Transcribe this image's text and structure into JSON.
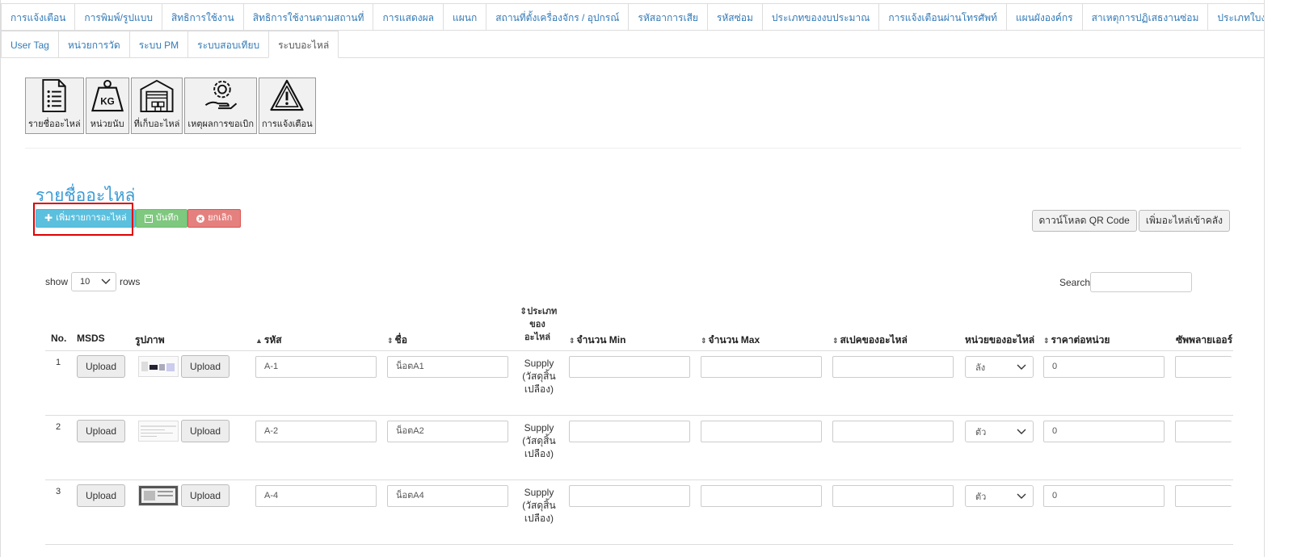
{
  "tabs_row1": [
    "การแจ้งเตือน",
    "การพิมพ์/รูปแบบ",
    "สิทธิการใช้งาน",
    "สิทธิการใช้งานตามสถานที่",
    "การแสดงผล",
    "แผนก",
    "สถานที่ตั้งเครื่องจักร / อุปกรณ์",
    "รหัสอาการเสีย",
    "รหัสซ่อม",
    "ประเภทของงบประมาณ",
    "การแจ้งเตือนผ่านโทรศัพท์",
    "แผนผังองค์กร",
    "สาเหตุการปฏิเสธงานซ่อม",
    "ประเภทใบงานซ่อม"
  ],
  "tabs_row2": [
    "User Tag",
    "หน่วยการวัด",
    "ระบบ PM",
    "ระบบสอบเทียบ",
    "ระบบอะไหล่"
  ],
  "active_tab": "ระบบอะไหล่",
  "icon_buttons": [
    {
      "label": "รายชื่ออะไหล่",
      "icon": "list-document-icon"
    },
    {
      "label": "หน่วยนับ",
      "icon": "weight-kg-icon"
    },
    {
      "label": "ที่เก็บอะไหล่",
      "icon": "warehouse-icon"
    },
    {
      "label": "เหตุผลการขอเบิก",
      "icon": "hand-gear-icon"
    },
    {
      "label": "การแจ้งเตือน",
      "icon": "warning-triangle-icon"
    }
  ],
  "page_title": "รายชื่ออะไหล่",
  "actions": {
    "add": "เพิ่มรายการอะไหล่",
    "save": "บันทึก",
    "cancel": "ยกเลิก"
  },
  "right_actions": {
    "qr": "ดาวน์โหลด QR Code",
    "stock": "เพิ่มอะไหล่เข้าคลัง"
  },
  "table_controls": {
    "show": "show",
    "rows_value": "10",
    "rows": "rows",
    "search": "Search"
  },
  "columns": {
    "no": "No.",
    "msds": "MSDS",
    "image": "รูปภาพ",
    "code": "รหัส",
    "name": "ชื่อ",
    "type_lines": [
      "ประเภท",
      "ของ",
      "อะไหล่"
    ],
    "min": "จำนวน Min",
    "max": "จำนวน Max",
    "spec": "สเปคของอะไหล่",
    "unit": "หน่วยของอะไหล่",
    "price": "ราคาต่อหน่วย",
    "supplier": "ซัพพลายเออร์"
  },
  "upload_label": "Upload",
  "rows": [
    {
      "no": "1",
      "code": "A-1",
      "name": "น็อตA1",
      "type_lines": [
        "Supply",
        "(วัสดุสิ้น",
        "เปลือง)"
      ],
      "unit": "ลัง",
      "price": "0"
    },
    {
      "no": "2",
      "code": "A-2",
      "name": "น็อตA2",
      "type_lines": [
        "Supply",
        "(วัสดุสิ้น",
        "เปลือง)"
      ],
      "unit": "ตัว",
      "price": "0"
    },
    {
      "no": "3",
      "code": "A-4",
      "name": "น็อตA4",
      "type_lines": [
        "Supply",
        "(วัสดุสิ้น",
        "เปลือง)"
      ],
      "unit": "ตัว",
      "price": "0"
    }
  ]
}
